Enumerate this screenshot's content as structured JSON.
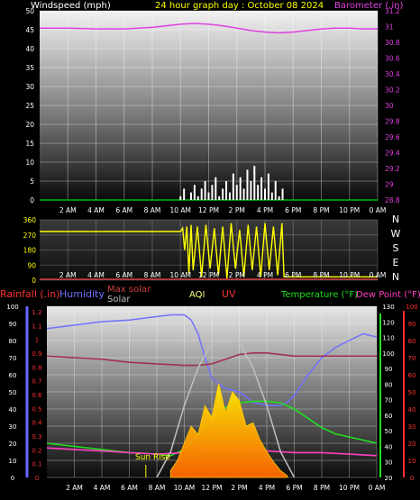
{
  "chart_data": [
    {
      "type": "line",
      "title": "24 hour graph day : October 08 2024",
      "left_axis_label": "Windspeed (mph)",
      "right_axis_label": "Barometer (.in)",
      "x_ticks": [
        "2 AM",
        "4 AM",
        "6 AM",
        "8 AM",
        "10 AM",
        "12 PM",
        "2 PM",
        "4 PM",
        "6 PM",
        "8 PM",
        "10 PM",
        "0 AM"
      ],
      "left_ticks": [
        "0",
        "5",
        "10",
        "15",
        "20",
        "25",
        "30",
        "35",
        "40",
        "45",
        "50"
      ],
      "right_ticks": [
        "28.8",
        "29",
        "29.2",
        "29.4",
        "29.6",
        "29.8",
        "30",
        "30.2",
        "30.4",
        "30.6",
        "30.8",
        "31",
        "31.2"
      ],
      "ylim_left": [
        0,
        50
      ],
      "ylim_right": [
        28.8,
        31.2
      ],
      "series": [
        {
          "name": "Barometer (.in)",
          "axis": "right",
          "color": "#e040e0",
          "x": [
            0,
            2,
            4,
            6,
            8,
            9,
            10,
            11,
            12,
            13,
            14,
            15,
            16,
            17,
            18,
            19,
            20,
            21,
            22,
            23,
            24
          ],
          "values": [
            30.98,
            30.98,
            30.97,
            30.97,
            30.99,
            31.01,
            31.03,
            31.04,
            31.03,
            31.01,
            30.98,
            30.95,
            30.93,
            30.92,
            30.93,
            30.95,
            30.97,
            30.98,
            30.98,
            30.97,
            30.97
          ]
        },
        {
          "name": "Windspeed (mph)",
          "axis": "left",
          "color": "#ffffff",
          "x": [
            10,
            10.25,
            10.5,
            10.75,
            11,
            11.25,
            11.5,
            11.75,
            12,
            12.25,
            12.5,
            12.75,
            13,
            13.25,
            13.5,
            13.75,
            14,
            14.25,
            14.5,
            14.75,
            15,
            15.25,
            15.5,
            15.75,
            16,
            16.25,
            16.5,
            16.75,
            17,
            17.25,
            17.5
          ],
          "values": [
            1,
            3,
            0,
            2,
            4,
            1,
            3,
            5,
            2,
            4,
            6,
            1,
            3,
            5,
            2,
            7,
            4,
            6,
            3,
            8,
            5,
            9,
            4,
            6,
            3,
            7,
            2,
            5,
            1,
            3,
            0
          ]
        }
      ]
    },
    {
      "type": "line",
      "series_name": "Wind direction",
      "left_ticks": [
        "0",
        "90",
        "180",
        "270",
        "360"
      ],
      "right_labels": [
        "N",
        "W",
        "S",
        "E",
        "N"
      ],
      "x_ticks": [
        "2 AM",
        "4 AM",
        "6 AM",
        "8 AM",
        "10 AM",
        "12 PM",
        "2 PM",
        "4 PM",
        "6 PM",
        "8 PM",
        "10 PM",
        "0 AM"
      ],
      "ylim": [
        0,
        360
      ],
      "series": [
        {
          "color": "#ffff00",
          "x": [
            0,
            10,
            10.15,
            10.3,
            10.45,
            10.6,
            10.75,
            10.9,
            11.2,
            11.5,
            11.8,
            12.1,
            12.4,
            12.7,
            13.0,
            13.3,
            13.6,
            13.9,
            14.2,
            14.5,
            14.8,
            15.1,
            15.4,
            15.7,
            16.0,
            16.3,
            16.6,
            16.9,
            17.2,
            17.35,
            17.5,
            24
          ],
          "values": [
            290,
            290,
            310,
            180,
            320,
            40,
            330,
            60,
            320,
            20,
            330,
            70,
            310,
            30,
            320,
            10,
            340,
            70,
            300,
            20,
            330,
            60,
            320,
            20,
            340,
            60,
            320,
            30,
            340,
            20,
            20,
            20
          ]
        }
      ]
    },
    {
      "type": "line",
      "labels": {
        "rainfall": "Rainfall (.in)",
        "humidity": "Humidity",
        "max_solar": "Max solar",
        "solar": "Solar",
        "aqi": "AQI",
        "uv": "UV",
        "temperature": "Temperature (°F)",
        "dew_point": "Dew Point (°F)",
        "sun_rise": "Sun Rise"
      },
      "colors": {
        "rainfall": "#ff3030",
        "humidity": "#7070ff",
        "max_solar": "#d04040",
        "solar": "#c0c0c0",
        "aqi": "#ffff80",
        "uv": "#ff3030",
        "temperature": "#20e020",
        "dew_point": "#ff40c0"
      },
      "x_ticks": [
        "2 AM",
        "4 AM",
        "6 AM",
        "8 AM",
        "10 AM",
        "12 PM",
        "2 PM",
        "4 PM",
        "6 PM",
        "8 PM",
        "10 PM",
        "0 AM"
      ],
      "humidity_ticks": [
        "0",
        "10",
        "20",
        "30",
        "40",
        "50",
        "60",
        "70",
        "80",
        "90",
        "100"
      ],
      "rain_ticks": [
        "0",
        "0.1",
        "0.2",
        "0.3",
        "0.4",
        "0.5",
        "0.6",
        "0.7",
        "0.8",
        "0.9",
        "1",
        "1.1",
        "1.2"
      ],
      "temp_ticks": [
        "20",
        "30",
        "40",
        "50",
        "60",
        "70",
        "80",
        "90",
        "100",
        "110",
        "120",
        "130"
      ],
      "uv_ticks": [
        "0",
        "10",
        "20",
        "30",
        "40",
        "50",
        "60",
        "70",
        "80",
        "90",
        "100"
      ],
      "ylim_humidity": [
        0,
        100
      ],
      "ylim_temp": [
        20,
        130
      ],
      "ylim_solar": [
        0,
        1000
      ],
      "series": [
        {
          "name": "Humidity",
          "axis": "humidity",
          "x": [
            0,
            2,
            4,
            6,
            8,
            9,
            10,
            10.5,
            11,
            11.5,
            12,
            13,
            14,
            15,
            16,
            17,
            17.5,
            18,
            19,
            20,
            21,
            22,
            23,
            24
          ],
          "values": [
            87,
            89,
            91,
            92,
            94,
            95,
            95,
            92,
            84,
            70,
            58,
            52,
            50,
            44,
            42,
            42,
            44,
            48,
            60,
            70,
            76,
            80,
            84,
            82
          ]
        },
        {
          "name": "Temperature (°F)",
          "axis": "temp",
          "x": [
            0,
            2,
            4,
            6,
            8,
            9,
            10,
            11,
            12,
            13,
            14,
            15,
            16,
            17,
            18,
            19,
            20,
            21,
            22,
            23,
            24
          ],
          "values": [
            42,
            40,
            38,
            36,
            35,
            34,
            38,
            48,
            58,
            65,
            68,
            69,
            69,
            68,
            64,
            58,
            52,
            48,
            46,
            44,
            42
          ]
        },
        {
          "name": "Dew Point (°F)",
          "axis": "temp",
          "x": [
            0,
            2,
            4,
            6,
            8,
            10,
            12,
            14,
            16,
            18,
            20,
            22,
            24
          ],
          "values": [
            39,
            38,
            37,
            36,
            35,
            36,
            38,
            38,
            37,
            36,
            36,
            35,
            34
          ]
        },
        {
          "x": [
            0,
            2,
            4,
            6,
            8,
            10,
            11,
            12,
            13,
            14,
            15,
            16,
            17,
            18,
            20,
            22,
            24
          ],
          "values": [
            98,
            97,
            96,
            94,
            93,
            92,
            92,
            93,
            96,
            99,
            100,
            100,
            99,
            98,
            98,
            98,
            98
          ],
          "axis": "temp"
        },
        {
          "name": "Max solar",
          "axis": "solar",
          "x": [
            8,
            9,
            10,
            11,
            12,
            13,
            14,
            15,
            16,
            17,
            18
          ],
          "values": [
            0,
            150,
            420,
            640,
            790,
            840,
            790,
            640,
            420,
            150,
            0
          ]
        },
        {
          "name": "Solar",
          "axis": "solar",
          "x": [
            9,
            9.5,
            10,
            10.5,
            11,
            11.5,
            12,
            12.5,
            13,
            13.5,
            14,
            14.5,
            15,
            15.5,
            16,
            16.5,
            17,
            17.5
          ],
          "values": [
            40,
            100,
            200,
            300,
            250,
            420,
            350,
            550,
            380,
            500,
            450,
            300,
            320,
            220,
            150,
            90,
            40,
            10
          ]
        }
      ]
    }
  ]
}
